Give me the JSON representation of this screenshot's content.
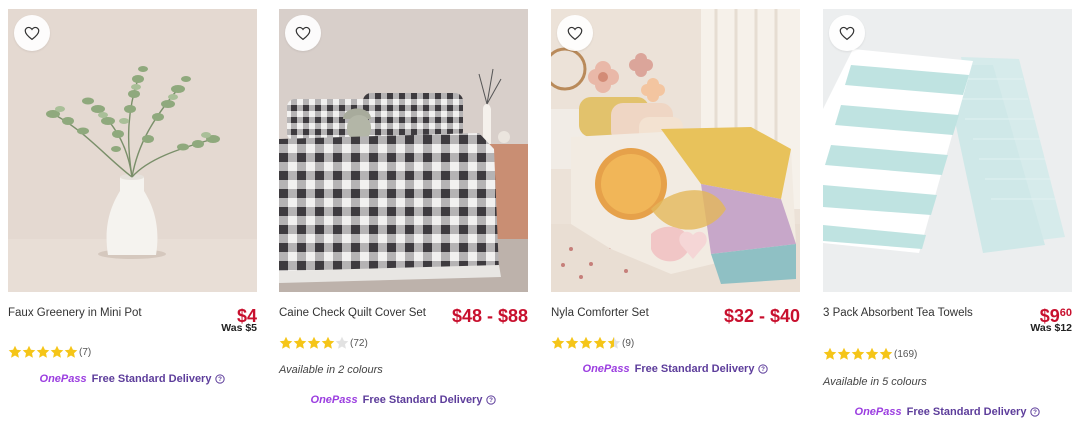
{
  "products": [
    {
      "name": "Faux Greenery in Mini Pot",
      "price": "$4",
      "was": "Was $5",
      "rating": 5,
      "reviews": "(7)",
      "colours": "",
      "delivery_brand": "OnePass",
      "delivery_label": "Free Standard Delivery"
    },
    {
      "name": "Caine Check Quilt Cover Set",
      "price": "$48 - $88",
      "was": "",
      "rating": 4,
      "reviews": "(72)",
      "colours": "Available in 2 colours",
      "delivery_brand": "OnePass",
      "delivery_label": "Free Standard Delivery"
    },
    {
      "name": "Nyla Comforter Set",
      "price": "$32 - $40",
      "was": "",
      "rating": 4.5,
      "reviews": "(9)",
      "colours": "",
      "delivery_brand": "OnePass",
      "delivery_label": "Free Standard Delivery"
    },
    {
      "name": "3 Pack Absorbent Tea Towels",
      "price_dollars": "$9",
      "price_cents": "60",
      "was": "Was $12",
      "rating": 5,
      "reviews": "(169)",
      "colours": "Available in 5 colours",
      "delivery_brand": "OnePass",
      "delivery_label": "Free Standard Delivery"
    }
  ],
  "icons": {
    "wishlist": "heart-outline-icon",
    "star": "star-icon",
    "info": "info-circle-icon"
  },
  "colors": {
    "price": "#c8102e",
    "star": "#f5c518",
    "onepass": "#9b3de0",
    "delivery_text": "#5d3d9b"
  }
}
